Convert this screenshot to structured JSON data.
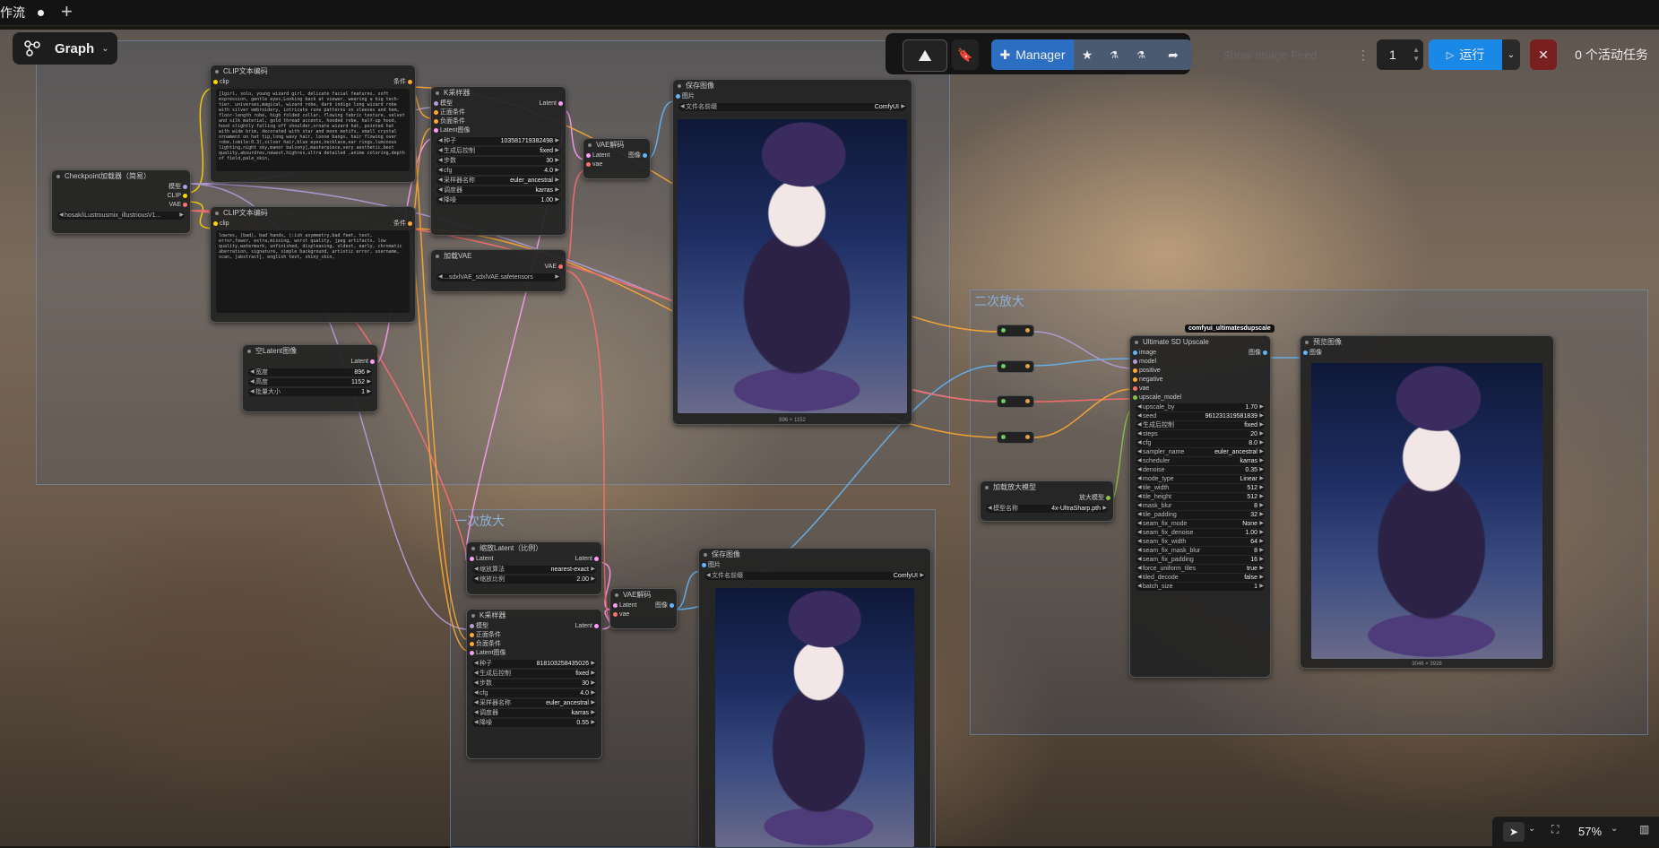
{
  "tab": {
    "title": "作流"
  },
  "graph_menu": {
    "label": "Graph"
  },
  "toolbar": {
    "manager_label": "Manager",
    "show_image_feed": "Show Image Feed",
    "batch_count": "1",
    "run_label": "运行",
    "active_tasks": "0 个活动任务"
  },
  "groups": {
    "second_upscale": "二次放大",
    "first_upscale": "一次放大"
  },
  "nodes": {
    "clip1": {
      "title": "CLIP文本编码",
      "input": "clip",
      "output": "条件",
      "text": "[1girl, solo, young wizard girl, delicate facial features, soft expression, gentle eyes,Looking back at viewer, wearing a big tech-tier. universes,magical, wizard robe, dark indigo long wizard robe with silver embroidery, intricate rune patterns on sleeves and hem, floor-length robe, high folded collar, flowing fabric texture, velvet and silk material, gold thread accents, hooded robe, half-up hood, hood slightly falling off shoulder,ornate wizard hat, pointed hat with wide brim, decorated with star and moon motifs, small crystal ornament on hat tip,long wavy hair, loose bangs, hair flowing over robe,(smile:0.3),silver hair,blue eyes,necklace,ear rings,luminous lighting,night sky,manor balcony],masterpiece,very aesthetic,best quality,absurdres,newest,highres,ultra detailed ,anime coloring,depth of field,pale_skin,"
    },
    "clip2": {
      "title": "CLIP文本编码",
      "input": "clip",
      "output": "条件",
      "text": "lowres, (bad), bad hands, (:ish asymmetry,bad feet, text, error,fewer, extra,missing, worst quality, jpeg artifacts, low quality,watermark, unfinished, displeasing, oldest, early, chromatic aberration, signature, simple background, artistic error, username, scan, [abstract], english text, shiny_skin,"
    },
    "checkpoint": {
      "title": "Checkpoint加载器（简易）",
      "out_model": "模型",
      "out_clip": "CLIP",
      "out_vae": "VAE",
      "ckpt": "hosaki\\Lustrousmix_illustriousV1..."
    },
    "ksampler1": {
      "title": "K采样器",
      "in_model": "模型",
      "in_pos": "正面条件",
      "in_neg": "负面条件",
      "in_latent": "Latent图像",
      "out": "Latent",
      "seed_label": "种子",
      "seed": "1035817193824​98",
      "control_label": "生成后控制",
      "control": "fixed",
      "steps_label": "步数",
      "steps": "30",
      "cfg_label": "cfg",
      "cfg": "4.0",
      "sampler_label": "采样器名称",
      "sampler": "euler_ancestral",
      "scheduler_label": "调度器",
      "scheduler": "karras",
      "denoise_label": "降噪",
      "denoise": "1.00"
    },
    "vaedecode1": {
      "title": "VAE解码",
      "in_latent": "Latent",
      "in_vae": "vae",
      "out": "图像"
    },
    "vaeloader": {
      "title": "加载VAE",
      "out": "VAE",
      "name": "...sdxlVAE_sdxlVAE.safetensors"
    },
    "emptylatent": {
      "title": "空Latent图像",
      "out": "Latent",
      "width_label": "宽度",
      "width": "896",
      "height_label": "高度",
      "height": "1152",
      "batch_label": "批量大小",
      "batch": "1"
    },
    "save1": {
      "title": "保存图像",
      "in": "图片",
      "prefix_label": "文件名前缀",
      "prefix": "ComfyUI",
      "size": "896 × 1152"
    },
    "scalelatent": {
      "title": "缩放Latent（比例）",
      "in": "Latent",
      "out": "Latent",
      "method_label": "缩放算法",
      "method": "nearest-exact",
      "scale_label": "缩放比例",
      "scale": "2.00"
    },
    "vaedecode2": {
      "title": "VAE解码",
      "in_latent": "Latent",
      "in_vae": "vae",
      "out": "图像"
    },
    "ksampler2": {
      "title": "K采样器",
      "in_model": "模型",
      "in_pos": "正面条件",
      "in_neg": "负面条件",
      "in_latent": "Latent图像",
      "out": "Latent",
      "seed_label": "种子",
      "seed": "818103258435026",
      "control_label": "生成后控制",
      "control": "fixed",
      "steps_label": "步数",
      "steps": "30",
      "cfg_label": "cfg",
      "cfg": "4.0",
      "sampler_label": "采样器名称",
      "sampler": "euler_ancestral",
      "scheduler_label": "调度器",
      "scheduler": "karras",
      "denoise_label": "降噪",
      "denoise": "0.55"
    },
    "save2": {
      "title": "保存图像",
      "in": "图片",
      "prefix_label": "文件名前缀",
      "prefix": "ComfyUI"
    },
    "upscaleloader": {
      "title": "加载放大模型",
      "out": "放大模型",
      "name_label": "模型名称",
      "name": "4x-UltraSharp.pth"
    },
    "usdu": {
      "badge": "comfyui_ultimatesdupscale",
      "title": "Ultimate SD Upscale",
      "out": "图像",
      "inputs": [
        "image",
        "model",
        "positive",
        "negative",
        "vae",
        "upscale_model"
      ],
      "widgets": [
        {
          "k": "upscale_by",
          "v": "1.70"
        },
        {
          "k": "seed",
          "v": "961231319581839"
        },
        {
          "k": "生成后控制",
          "v": "fixed"
        },
        {
          "k": "steps",
          "v": "20"
        },
        {
          "k": "cfg",
          "v": "8.0"
        },
        {
          "k": "sampler_name",
          "v": "euler_ancestral"
        },
        {
          "k": "scheduler",
          "v": "karras"
        },
        {
          "k": "denoise",
          "v": "0.35"
        },
        {
          "k": "mode_type",
          "v": "Linear"
        },
        {
          "k": "tile_width",
          "v": "512"
        },
        {
          "k": "tile_height",
          "v": "512"
        },
        {
          "k": "mask_blur",
          "v": "8"
        },
        {
          "k": "tile_padding",
          "v": "32"
        },
        {
          "k": "seam_fix_mode",
          "v": "None"
        },
        {
          "k": "seam_fix_denoise",
          "v": "1.00"
        },
        {
          "k": "seam_fix_width",
          "v": "64"
        },
        {
          "k": "seam_fix_mask_blur",
          "v": "8"
        },
        {
          "k": "seam_fix_padding",
          "v": "16"
        },
        {
          "k": "force_uniform_tiles",
          "v": "true"
        },
        {
          "k": "tiled_decode",
          "v": "false"
        },
        {
          "k": "batch_size",
          "v": "1"
        }
      ]
    },
    "preview": {
      "title": "预览图像",
      "in": "图像",
      "size": "3046 × 3926"
    }
  },
  "zoom": "57%",
  "colors": {
    "accent_blue": "#1a88e6",
    "manager_blue": "#2c7bd6",
    "stop_red": "#8a2020"
  }
}
